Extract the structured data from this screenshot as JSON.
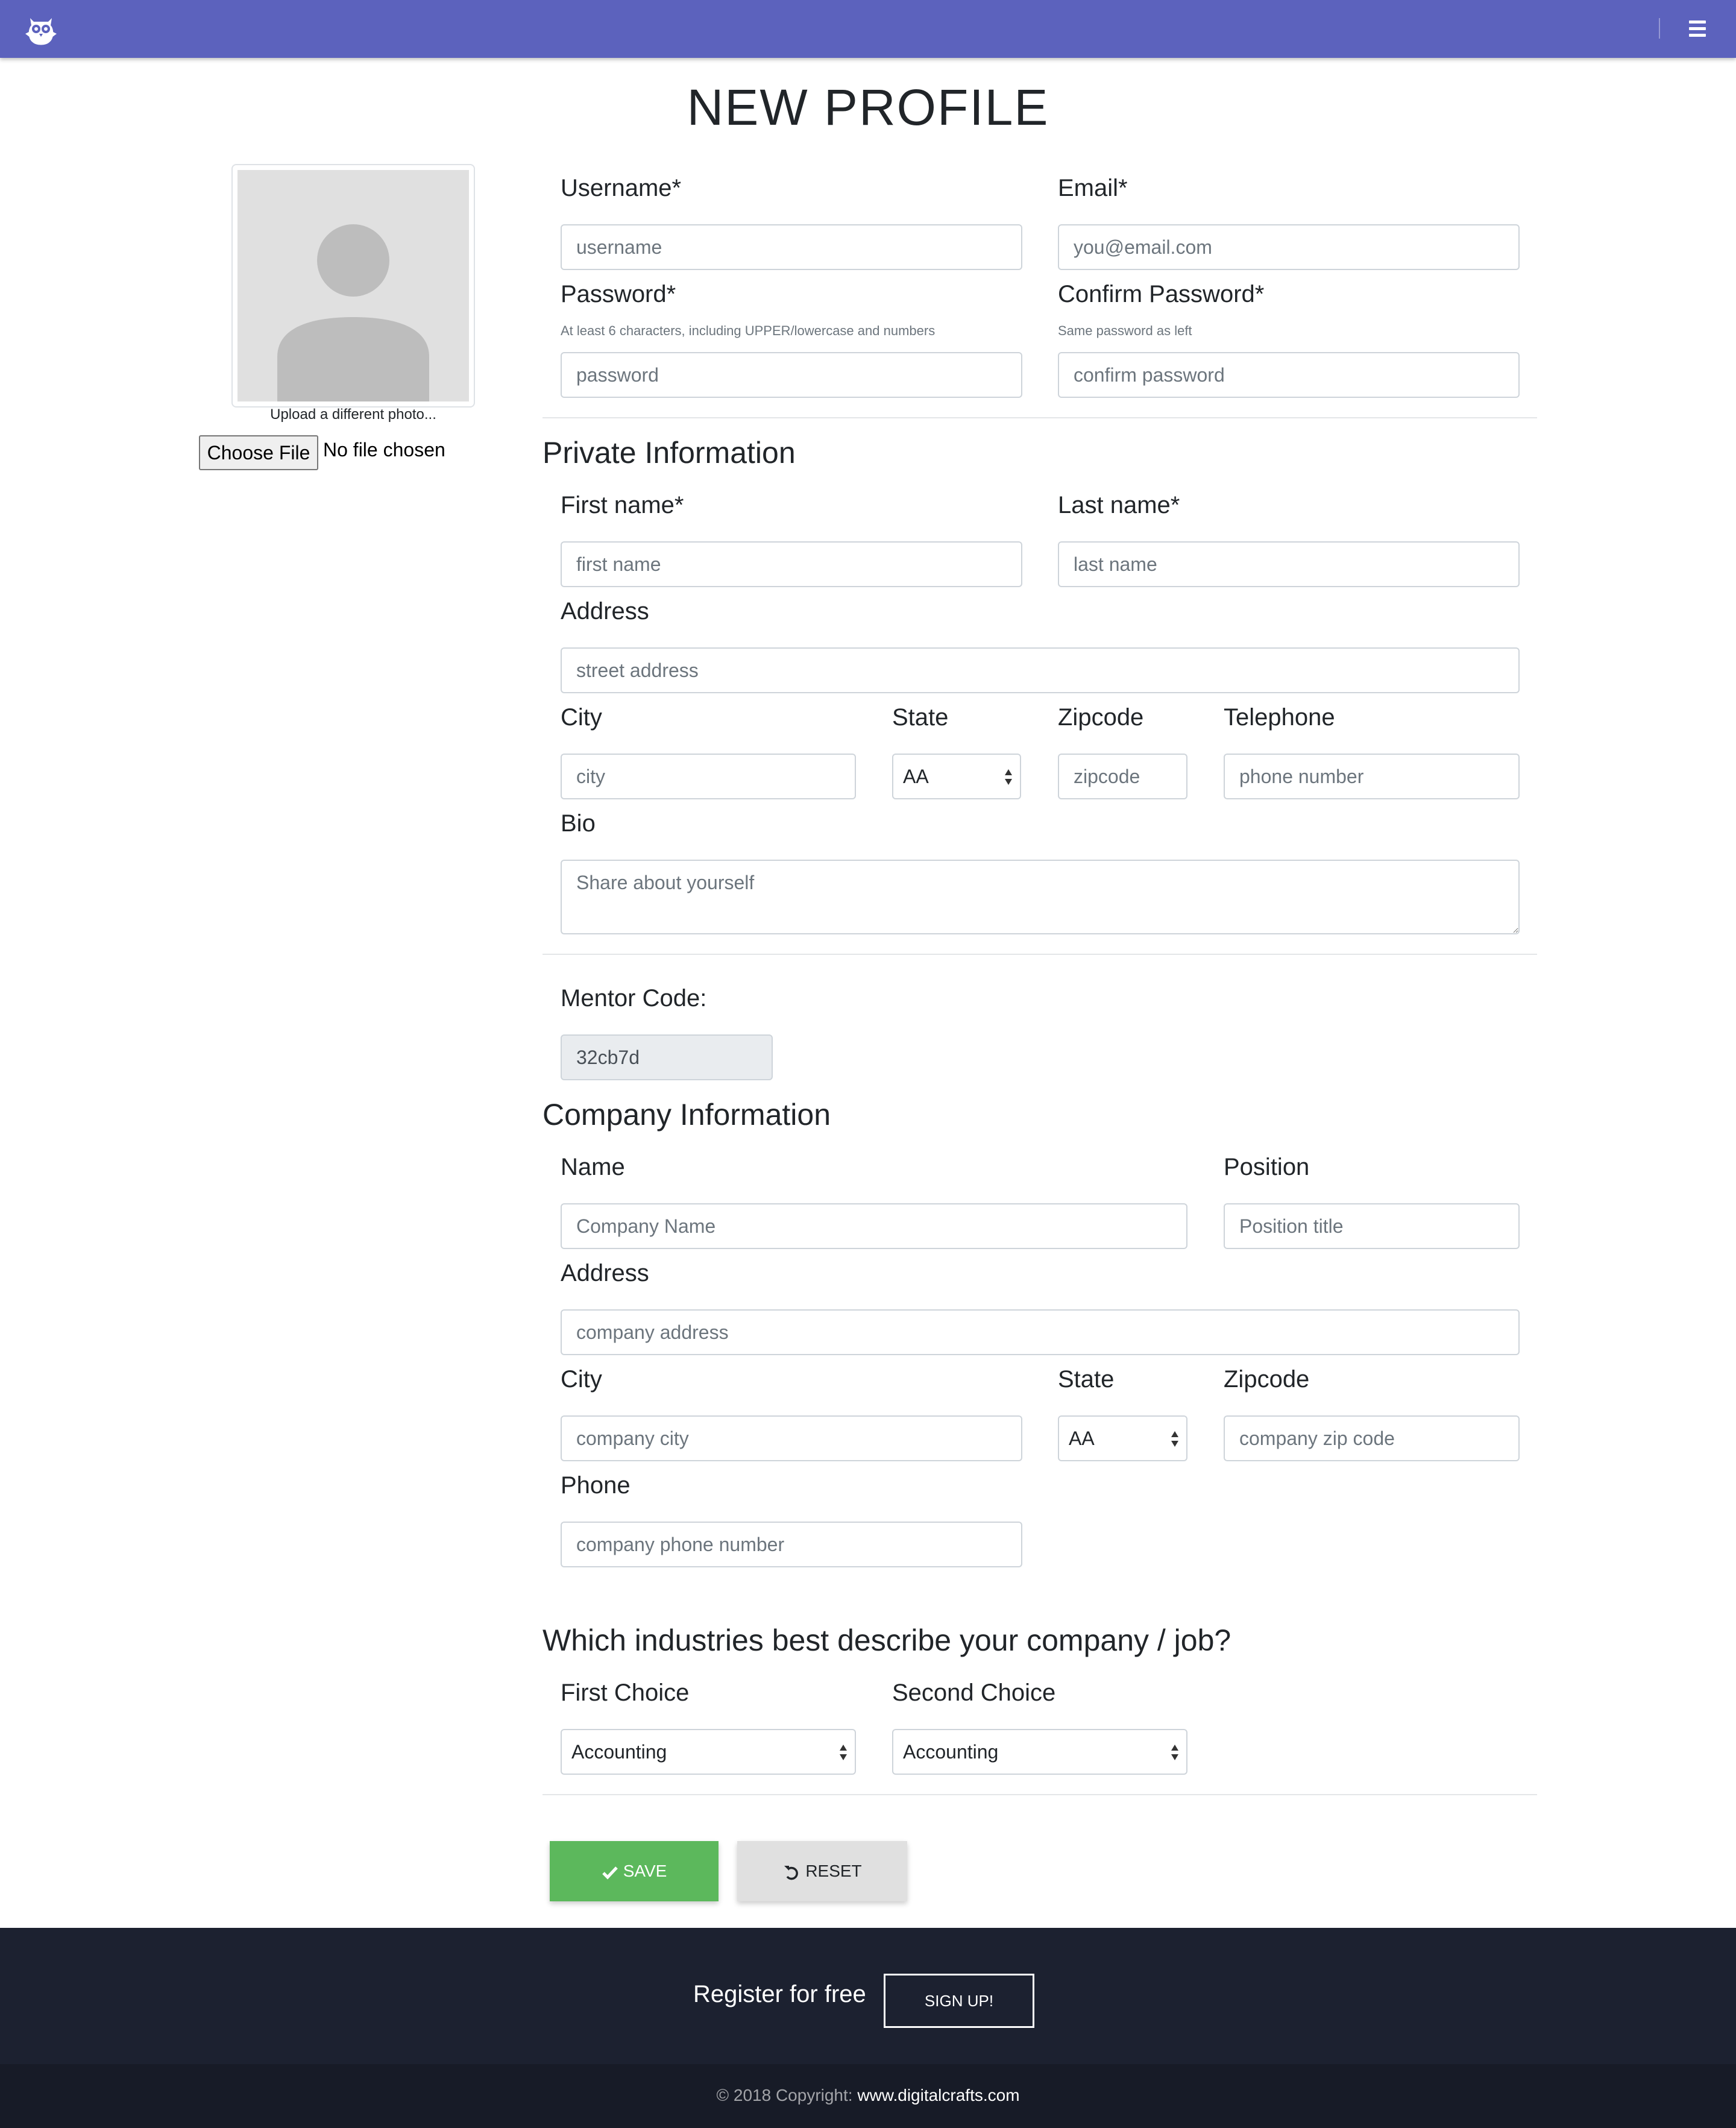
{
  "page": {
    "title": "NEW PROFILE"
  },
  "photo": {
    "caption": "Upload a different photo...",
    "file_button": "Choose File",
    "file_status": "No file chosen"
  },
  "account": {
    "username_label": "Username*",
    "username_placeholder": "username",
    "email_label": "Email*",
    "email_placeholder": "you@email.com",
    "password_label": "Password*",
    "password_hint": "At least 6 characters, including UPPER/lowercase and numbers",
    "password_placeholder": "password",
    "confirm_label": "Confirm Password*",
    "confirm_hint": "Same password as left",
    "confirm_placeholder": "confirm password"
  },
  "private_info": {
    "heading": "Private Information",
    "first_name_label": "First name*",
    "first_name_placeholder": "first name",
    "last_name_label": "Last name*",
    "last_name_placeholder": "last name",
    "address_label": "Address",
    "address_placeholder": "street address",
    "city_label": "City",
    "city_placeholder": "city",
    "state_label": "State",
    "state_value": "AA",
    "zip_label": "Zipcode",
    "zip_placeholder": "zipcode",
    "phone_label": "Telephone",
    "phone_placeholder": "phone number",
    "bio_label": "Bio",
    "bio_placeholder": "Share about yourself"
  },
  "mentor": {
    "label": "Mentor Code:",
    "value": "32cb7d"
  },
  "company_info": {
    "heading": "Company Information",
    "name_label": "Name",
    "name_placeholder": "Company Name",
    "position_label": "Position",
    "position_placeholder": "Position title",
    "address_label": "Address",
    "address_placeholder": "company address",
    "city_label": "City",
    "city_placeholder": "company city",
    "state_label": "State",
    "state_value": "AA",
    "zip_label": "Zipcode",
    "zip_placeholder": "company zip code",
    "phone_label": "Phone",
    "phone_placeholder": "company phone number"
  },
  "industries": {
    "heading": "Which industries best describe your company / job?",
    "first_label": "First Choice",
    "first_value": "Accounting",
    "second_label": "Second Choice",
    "second_value": "Accounting"
  },
  "actions": {
    "save_label": "SAVE",
    "reset_label": "RESET"
  },
  "footer": {
    "register_text": "Register for free",
    "signup_label": "SIGN UP!",
    "copyright_prefix": "© 2018 Copyright:",
    "copyright_link": "www.digitalcrafts.com"
  },
  "colors": {
    "navbar": "#5c62bd",
    "save_button": "#5cb85c",
    "reset_button": "#e0e0e0",
    "footer_top": "#1c2130",
    "footer_bottom": "#171b27"
  },
  "icons": {
    "logo": "owl-logo-icon",
    "menu": "hamburger-menu-icon",
    "save": "checkmark-icon",
    "reset": "undo-icon",
    "avatar": "avatar-placeholder-icon"
  }
}
